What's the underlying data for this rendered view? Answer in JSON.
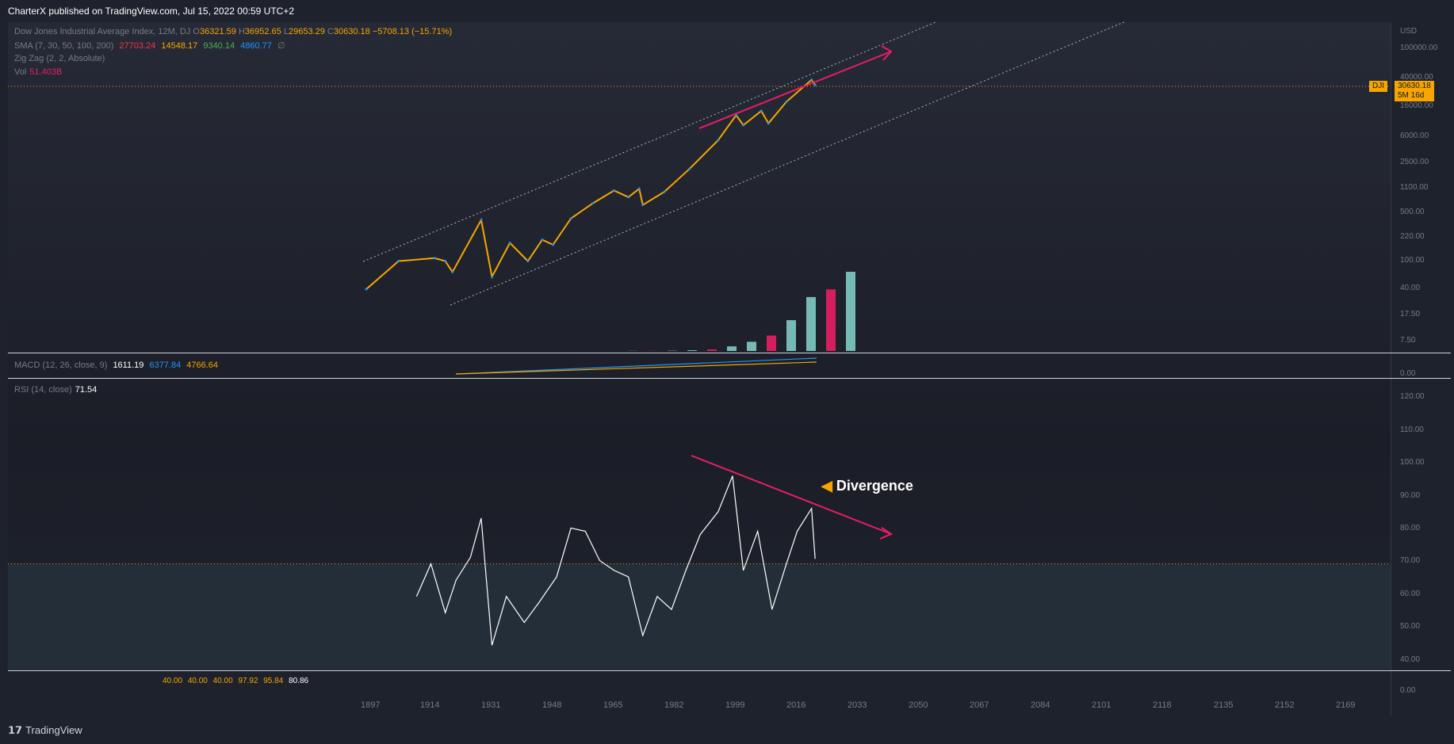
{
  "header": {
    "publisher_line": "CharterX published on TradingView.com, Jul 15, 2022 00:59 UTC+2"
  },
  "legend": {
    "title": "Dow Jones Industrial Average Index, 12M, DJ",
    "ohlc": {
      "o_label": "O",
      "o": "36321.59",
      "h_label": "H",
      "h": "36952.65",
      "l_label": "L",
      "l": "29653.29",
      "c_label": "C",
      "c": "30630.18",
      "chg": "−5708.13 (−15.71%)"
    },
    "sma_label": "SMA (7, 30, 50, 100, 200)",
    "sma_values": [
      "27703.24",
      "14548.17",
      "9340.14",
      "4860.77",
      "∅"
    ],
    "zigzag_label": "Zig Zag (2, 2, Absolute)",
    "vol_label": "Vol",
    "vol_value": "51.403B",
    "macd_label": "MACD (12, 26, close, 9)",
    "macd_values": [
      "1611.19",
      "6377.84",
      "4766.64"
    ],
    "rsi_label": "RSI (14, close)",
    "rsi_value": "71.54",
    "bottom_values": [
      "40.00",
      "40.00",
      "40.00",
      "97.92",
      "95.84",
      "80.86"
    ]
  },
  "badges": {
    "symbol": "DJI",
    "price": "30630.18",
    "countdown": "5M 16d"
  },
  "annotation": {
    "divergence": "Divergence"
  },
  "axis": {
    "currency": "USD",
    "price_ticks": [
      "100000.00",
      "40000.00",
      "16000.00",
      "6000.00",
      "2500.00",
      "1100.00",
      "500.00",
      "220.00",
      "100.00",
      "40.00",
      "17.50",
      "7.50"
    ],
    "macd_ticks": [
      "0.00"
    ],
    "rsi_ticks": [
      "120.00",
      "110.00",
      "100.00",
      "90.00",
      "80.00",
      "70.00",
      "60.00",
      "50.00",
      "40.00"
    ],
    "bottom_ticks": [
      "0.00"
    ],
    "x_ticks": [
      "1897",
      "1914",
      "1931",
      "1948",
      "1965",
      "1982",
      "1999",
      "2016",
      "2033",
      "2050",
      "2067",
      "2084",
      "2101",
      "2118",
      "2135",
      "2152",
      "2169"
    ]
  },
  "footer": {
    "brand": "TradingView"
  },
  "colors": {
    "accent_orange": "#f7a600",
    "pink": "#e91e63",
    "sma7": "#f23645",
    "sma30": "#f7a600",
    "sma50": "#4caf50",
    "sma100": "#2196f3",
    "vol_up": "#80cbc4",
    "vol_down": "#e91e63"
  },
  "chart_data": [
    {
      "type": "line",
      "title": "Dow Jones Industrial Average Index, 12M, DJ",
      "scale": "log",
      "ylim": [
        7.5,
        100000
      ],
      "x": [
        1897,
        1906,
        1916,
        1919,
        1921,
        1929,
        1932,
        1937,
        1942,
        1946,
        1949,
        1954,
        1960,
        1966,
        1970,
        1973,
        1974,
        1980,
        1987,
        1995,
        2000,
        2002,
        2007,
        2009,
        2014,
        2021,
        2022
      ],
      "series": [
        {
          "name": "DJI (close)",
          "values": [
            40,
            100,
            110,
            100,
            70,
            380,
            60,
            180,
            100,
            200,
            170,
            400,
            650,
            990,
            800,
            1050,
            620,
            950,
            2000,
            5100,
            11500,
            8300,
            13200,
            8800,
            17800,
            36300,
            30630
          ]
        }
      ],
      "volume": {
        "values_b": [
          0.1,
          0.1,
          0.2,
          0.5,
          1,
          3,
          6,
          10,
          20,
          35,
          40,
          51.4
        ]
      }
    },
    {
      "type": "line",
      "title": "RSI (14, close)",
      "ylim": [
        40,
        120
      ],
      "x": [
        1911,
        1915,
        1919,
        1922,
        1926,
        1929,
        1932,
        1936,
        1941,
        1945,
        1950,
        1954,
        1958,
        1962,
        1966,
        1970,
        1974,
        1978,
        1982,
        1986,
        1990,
        1995,
        1999,
        2002,
        2006,
        2010,
        2014,
        2017,
        2021,
        2022
      ],
      "series": [
        {
          "name": "RSI",
          "values": [
            60,
            70,
            55,
            65,
            72,
            84,
            45,
            60,
            52,
            58,
            66,
            81,
            80,
            71,
            68,
            66,
            48,
            60,
            56,
            68,
            79,
            86,
            97,
            68,
            80,
            56,
            70,
            80,
            87,
            71.54
          ]
        }
      ]
    }
  ]
}
